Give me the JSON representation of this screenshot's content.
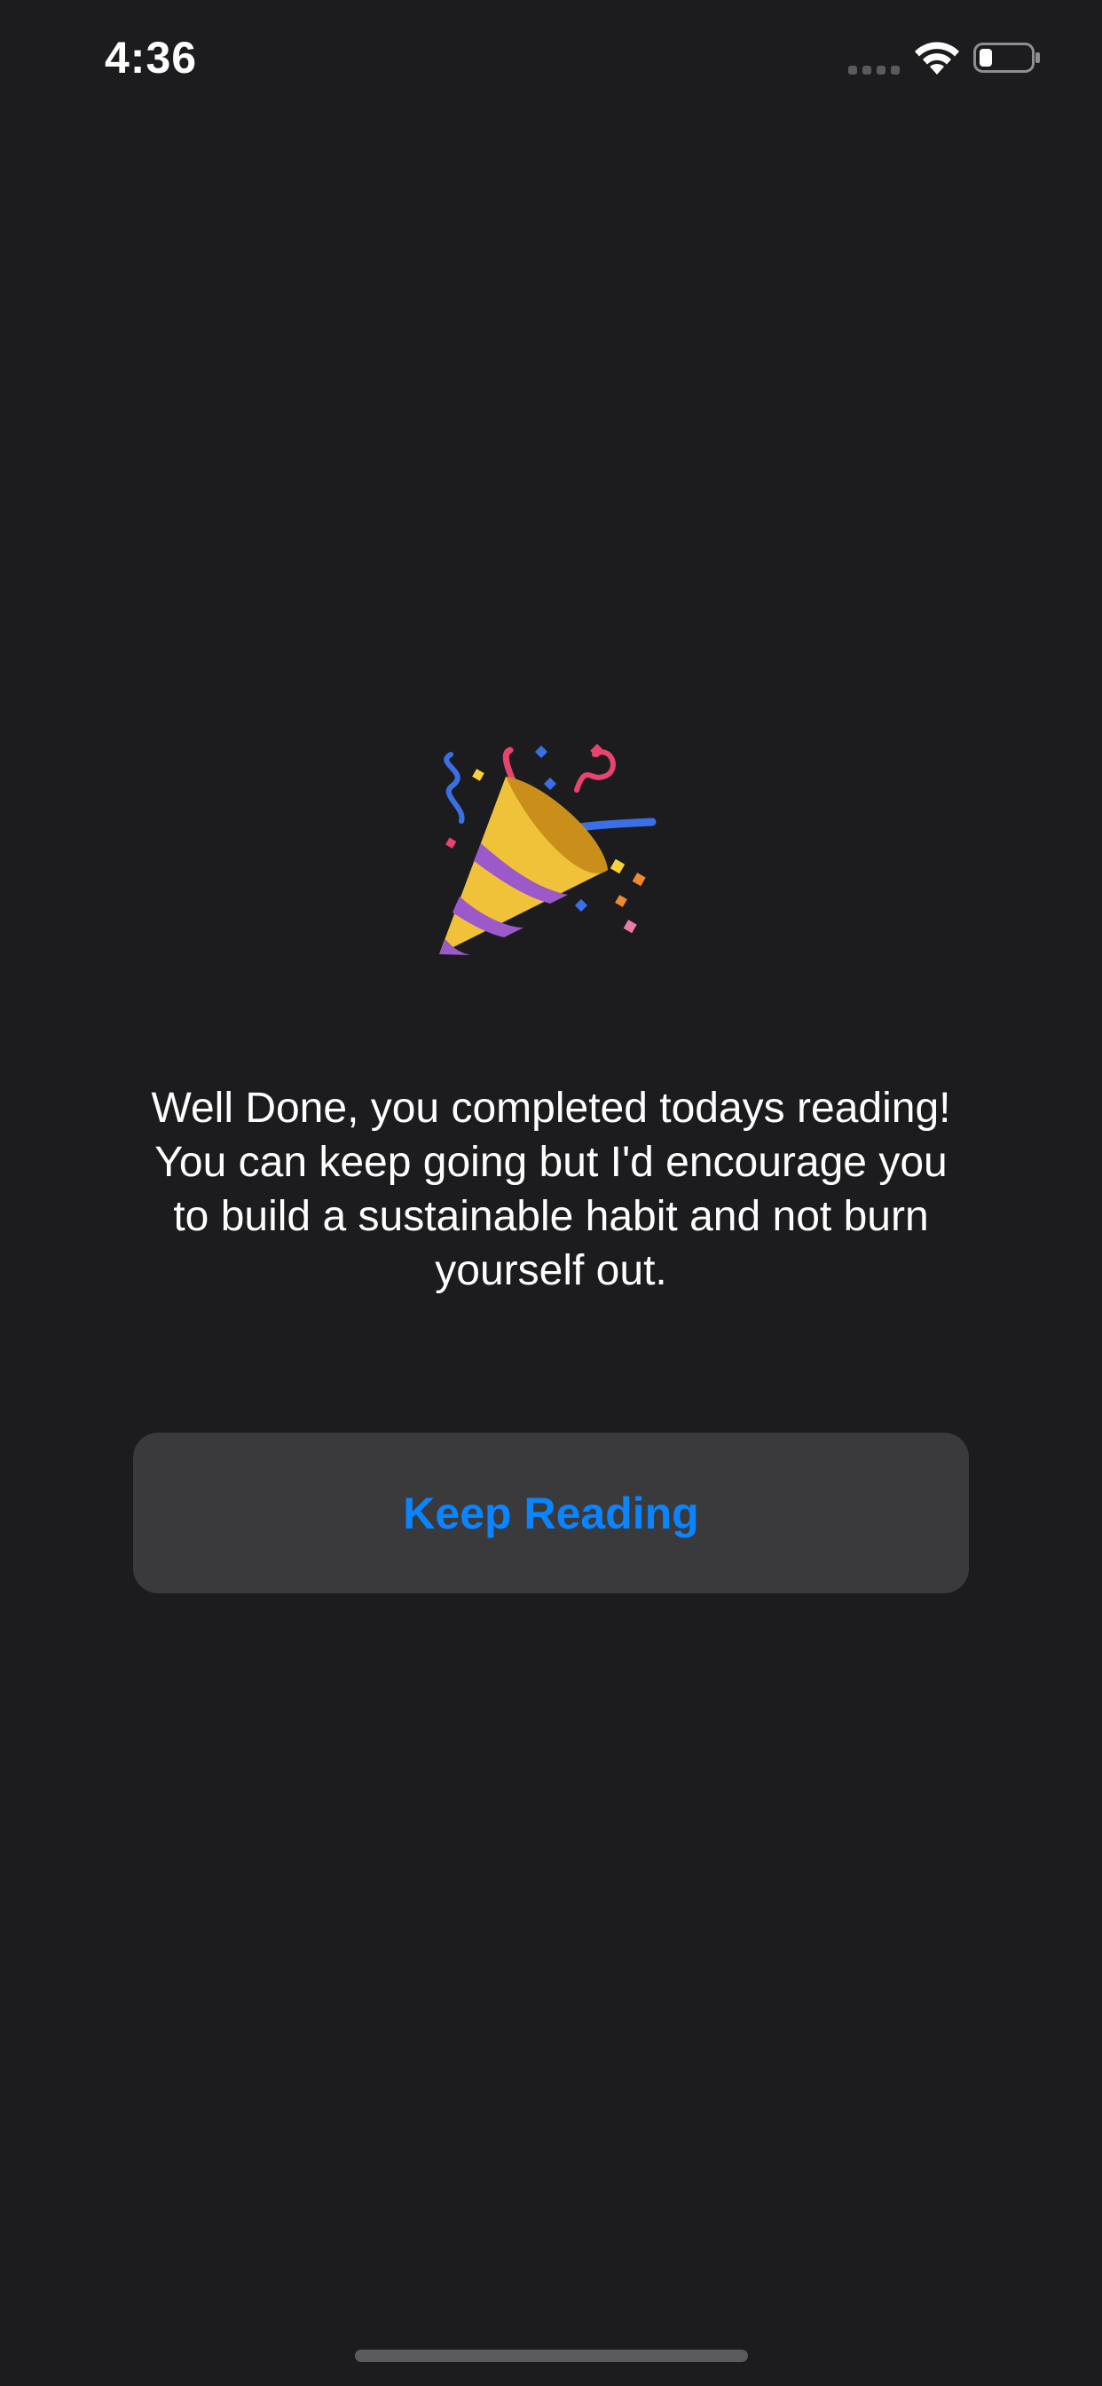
{
  "status_bar": {
    "time": "4:36",
    "signal_icon": "cellular-signal-icon",
    "wifi_icon": "wifi-icon",
    "battery_icon": "battery-icon",
    "battery_level": 0.2
  },
  "main": {
    "emoji_icon": "party-popper-icon",
    "message": "Well Done, you completed todays reading! You can keep going but I'd encourage you to build a sustainable habit and not burn yourself out.",
    "button_label": "Keep Reading"
  },
  "colors": {
    "background": "#1c1c1e",
    "button_background": "#3a3a3c",
    "accent": "#0a84ff",
    "text": "#ffffff"
  }
}
